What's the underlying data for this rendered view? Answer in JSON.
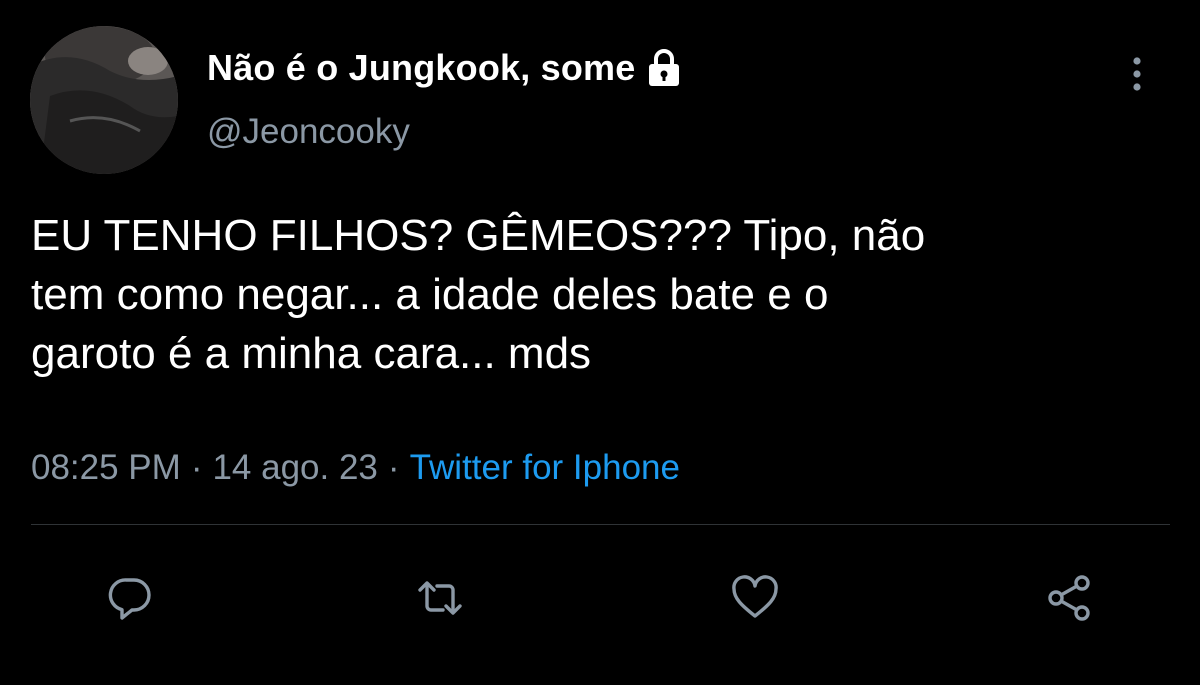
{
  "author": {
    "display_name": "Não é o Jungkook, some",
    "handle": "@Jeoncooky",
    "protected_icon": "lock-icon",
    "avatar": "avatar"
  },
  "tweet": {
    "text_lines": [
      "EU TENHO FILHOS? GÊMEOS??? Tipo, não",
      "tem como negar... a idade deles bate e o",
      "garoto é a minha cara... mds"
    ],
    "time": "08:25 PM",
    "date": "14 ago. 23",
    "separator": "·",
    "source": "Twitter for Iphone"
  },
  "actions": [
    {
      "name": "reply",
      "icon": "reply-icon"
    },
    {
      "name": "retweet",
      "icon": "retweet-icon"
    },
    {
      "name": "like",
      "icon": "heart-icon"
    },
    {
      "name": "share",
      "icon": "share-icon"
    }
  ],
  "colors": {
    "background": "#000000",
    "primary_text": "#ffffff",
    "secondary_text": "#8b98a5",
    "link": "#1d9bf0",
    "divider": "#2f3336"
  }
}
